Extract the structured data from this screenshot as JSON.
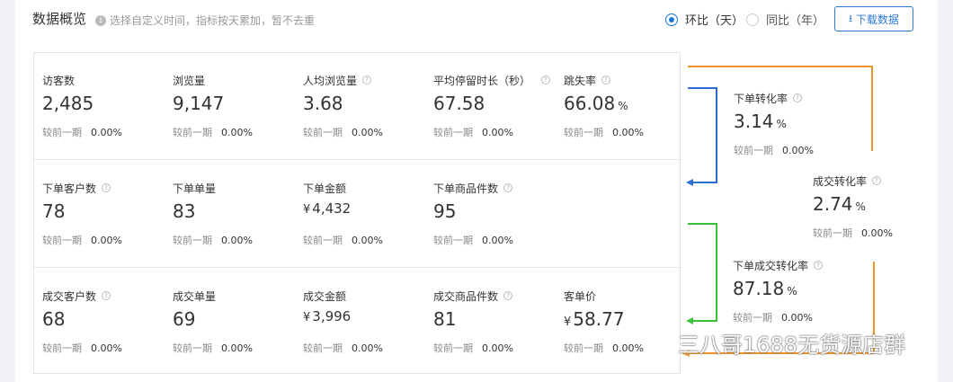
{
  "header": {
    "title": "数据概览",
    "hint": "选择自定义时间，指标按天累加，暂不去重",
    "radio_options": [
      {
        "label": "环比（天）",
        "selected": true
      },
      {
        "label": "同比（年）",
        "selected": false
      }
    ],
    "download_label": "下载数据"
  },
  "compare_label": "较前一期",
  "rows": [
    [
      {
        "label": "访客数",
        "value": "2,485",
        "change": "0.00%"
      },
      {
        "label": "浏览量",
        "value": "9,147",
        "change": "0.00%"
      },
      {
        "label": "人均浏览量",
        "value": "3.68",
        "change": "0.00%",
        "help": "?"
      },
      {
        "label": "平均停留时长（秒）",
        "value": "67.58",
        "change": "0.00%",
        "help": "?"
      },
      {
        "label": "跳失率",
        "value": "66.08",
        "unit": "%",
        "change": "0.00%",
        "help": "?"
      }
    ],
    [
      {
        "label": "下单客户数",
        "value": "78",
        "change": "0.00%",
        "help": "?"
      },
      {
        "label": "下单单量",
        "value": "83",
        "change": "0.00%"
      },
      {
        "label": "下单金额",
        "currency": "¥",
        "value": "4,432",
        "change": "0.00%"
      },
      {
        "label": "下单商品件数",
        "value": "95",
        "change": "0.00%",
        "help": "?"
      }
    ],
    [
      {
        "label": "成交客户数",
        "value": "68",
        "change": "0.00%",
        "help": "?"
      },
      {
        "label": "成交单量",
        "value": "69",
        "change": "0.00%"
      },
      {
        "label": "成交金额",
        "currency": "¥",
        "value": "3,996",
        "change": "0.00%"
      },
      {
        "label": "成交商品件数",
        "value": "81",
        "change": "0.00%",
        "help": "?"
      },
      {
        "label": "客单价",
        "currency": "¥",
        "value": "58.77",
        "change": "0.00%"
      }
    ]
  ],
  "conversions": [
    {
      "label": "下单转化率",
      "value": "3.14",
      "unit": "%",
      "change": "0.00%",
      "help": "?"
    },
    {
      "label": "成交转化率",
      "value": "2.74",
      "unit": "%",
      "change": "0.00%",
      "help": "?"
    },
    {
      "label": "下单成交转化率",
      "value": "87.18",
      "unit": "%",
      "change": "0.00%",
      "help": "?"
    }
  ],
  "colors": {
    "accent": "#1677d2",
    "blue_arrow": "#2b6fd1",
    "green_arrow": "#3cc13b",
    "orange_arrow": "#f0952a"
  },
  "watermark": {
    "text": "三八哥1688无货源店群"
  }
}
